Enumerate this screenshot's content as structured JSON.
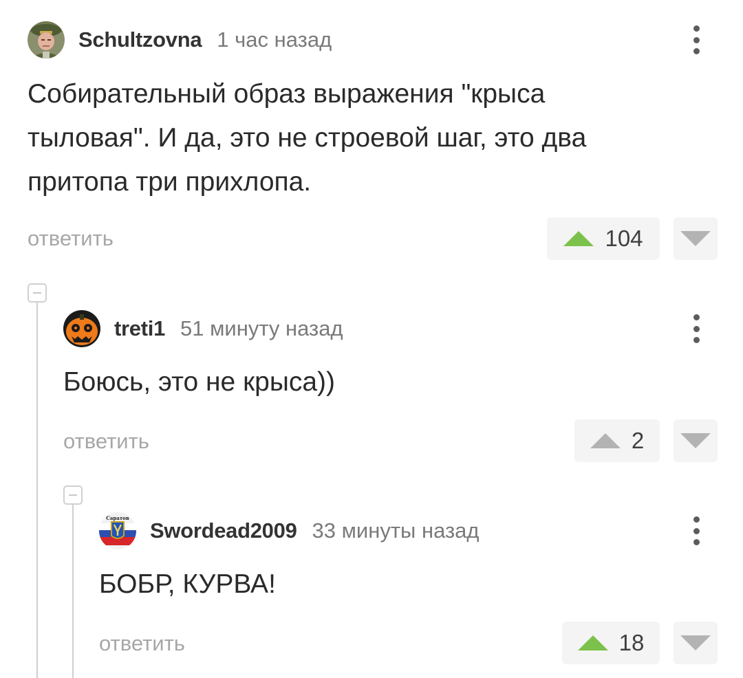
{
  "comments": [
    {
      "username": "Schultzovna",
      "time": "1 час назад",
      "text": "Собирательный образ выражения \"крыса тыловая\". И да, это не строевой шаг, это два притопа три прихлопа.",
      "reply_label": "ответить",
      "rating": "104",
      "upvote_color": "#7cc14b",
      "avatar_icon": "soldier-avatar"
    },
    {
      "username": "treti1",
      "time": "51 минуту назад",
      "text": "Боюсь, это не крыса))",
      "reply_label": "ответить",
      "rating": "2",
      "upvote_color": "#b3b3b3",
      "avatar_icon": "pumpkin-avatar"
    },
    {
      "username": "Swordead2009",
      "time": "33 минуты назад",
      "text": "БОБР, КУРВА!",
      "reply_label": "ответить",
      "rating": "18",
      "upvote_color": "#7cc14b",
      "avatar_icon": "saratov-emblem-avatar",
      "avatar_caption": "Саратов"
    }
  ],
  "colors": {
    "upvote_active": "#7cc14b",
    "upvote_neutral": "#b3b3b3",
    "downvote": "#b3b3b3",
    "secondary_text": "#7a7a7a",
    "reply_text": "#a7a7a7"
  }
}
